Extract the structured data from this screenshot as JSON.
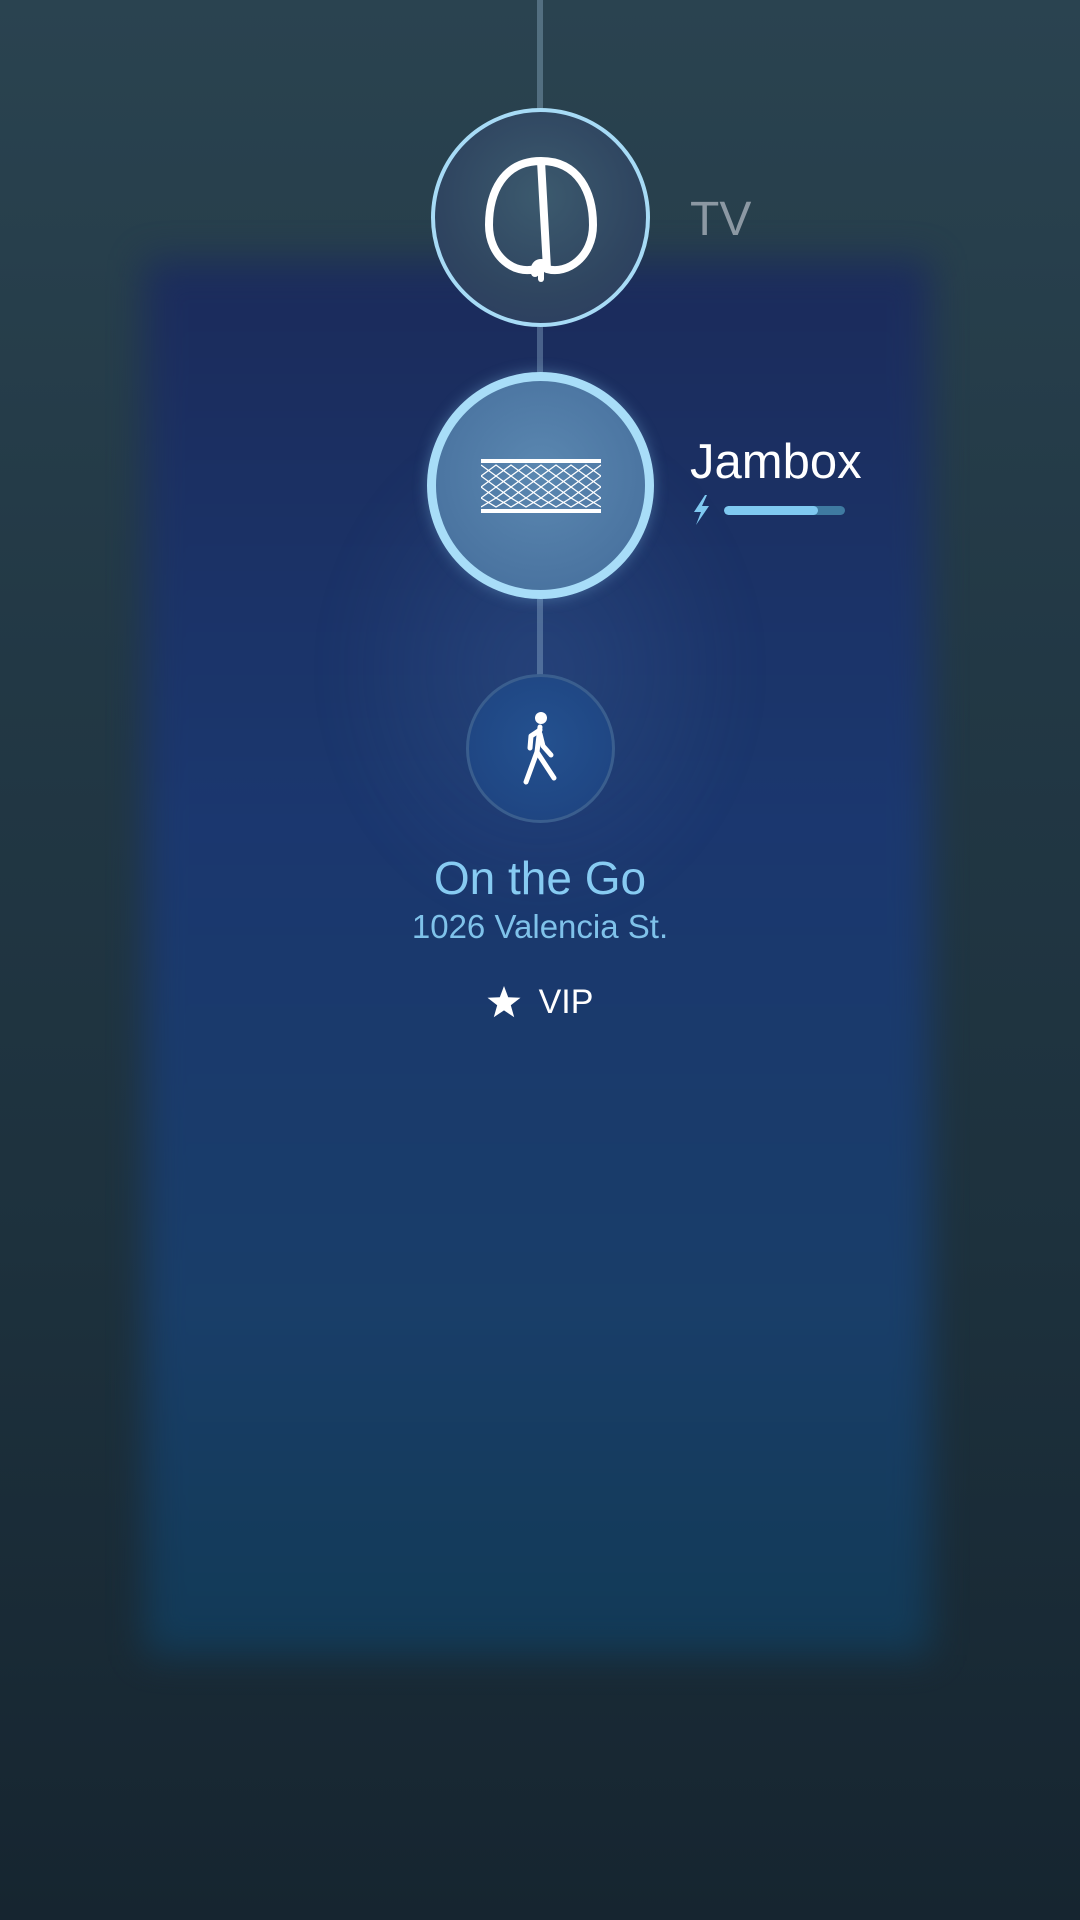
{
  "devices": [
    {
      "label": "TV",
      "icon": "headrest-icon",
      "state": "inactive"
    },
    {
      "label": "Jambox",
      "icon": "speaker-grille-icon",
      "state": "active",
      "battery_level": 0.78,
      "charging": true
    },
    {
      "label": "On the Go",
      "icon": "walking-person-icon",
      "state": "current"
    }
  ],
  "location": {
    "title": "On the Go",
    "address": "1026 Valencia St."
  },
  "vip": {
    "label": "VIP",
    "icon": "star-icon"
  },
  "colors": {
    "accent": "#87cbf2",
    "ring": "#a8ddf8",
    "battery_fill": "#7fc9f1",
    "battery_track": "#3f7aa1"
  }
}
